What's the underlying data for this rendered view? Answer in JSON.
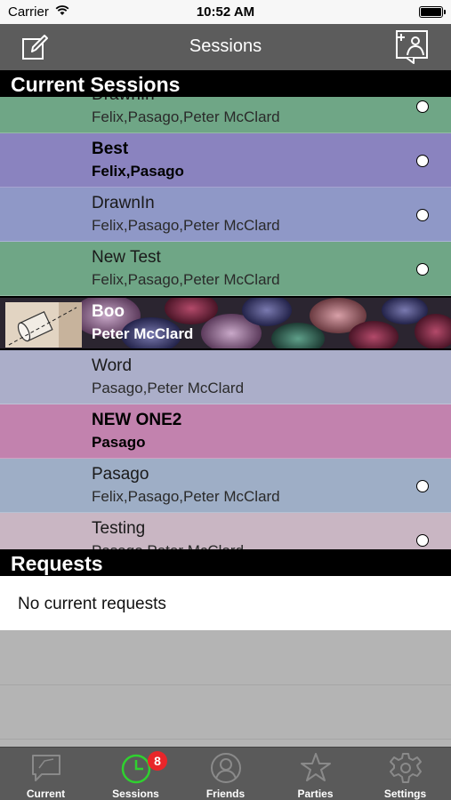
{
  "status_bar": {
    "carrier": "Carrier",
    "time": "10:52 AM"
  },
  "nav": {
    "title": "Sessions",
    "left_icon": "compose-icon",
    "right_icon": "add-photo-icon"
  },
  "current_sessions": {
    "header": "Current Sessions",
    "rows": [
      {
        "name": "DrawnIn",
        "members": "Felix,Pasago,Peter McClard",
        "color": "#6fa686",
        "bold": false,
        "photo": false,
        "radio": true
      },
      {
        "name": "Best",
        "members": "Felix,Pasago",
        "color": "#8a83bf",
        "bold": true,
        "photo": false,
        "radio": true
      },
      {
        "name": "DrawnIn",
        "members": "Felix,Pasago,Peter McClard",
        "color": "#8f98c7",
        "bold": false,
        "photo": false,
        "radio": true
      },
      {
        "name": "New Test",
        "members": "Felix,Pasago,Peter McClard",
        "color": "#6fa686",
        "bold": false,
        "photo": false,
        "radio": true
      },
      {
        "name": "Boo",
        "members": "Peter McClard",
        "color": "#333333",
        "bold": true,
        "photo": true,
        "radio": false
      },
      {
        "name": "Word",
        "members": "Pasago,Peter McClard",
        "color": "#abaec9",
        "bold": false,
        "photo": false,
        "radio": false
      },
      {
        "name": "NEW ONE2",
        "members": "Pasago",
        "color": "#c282ae",
        "bold": true,
        "photo": false,
        "radio": false
      },
      {
        "name": "Pasago",
        "members": "Felix,Pasago,Peter McClard",
        "color": "#9eaec6",
        "bold": false,
        "photo": false,
        "radio": true
      },
      {
        "name": "Testing",
        "members": "Pasago,Peter McClard",
        "color": "#c9b6c3",
        "bold": false,
        "photo": false,
        "radio": true
      }
    ]
  },
  "requests": {
    "header": "Requests",
    "empty_text": "No current requests"
  },
  "tabs": [
    {
      "label": "Current",
      "icon": "chat-bubble-icon",
      "active": false
    },
    {
      "label": "Sessions",
      "icon": "clock-icon",
      "active": true,
      "badge": "8"
    },
    {
      "label": "Friends",
      "icon": "person-icon",
      "active": false
    },
    {
      "label": "Parties",
      "icon": "star-icon",
      "active": false
    },
    {
      "label": "Settings",
      "icon": "gear-icon",
      "active": false
    }
  ]
}
